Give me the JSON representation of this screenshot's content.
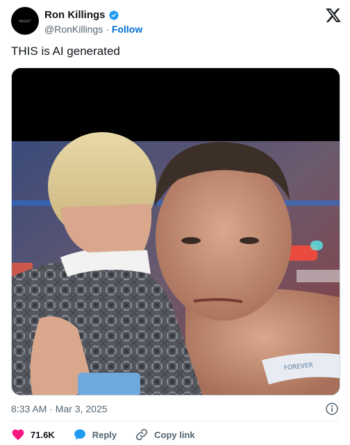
{
  "tweet": {
    "author": {
      "display_name": "Ron Killings",
      "handle": "@RonKillings",
      "follow_label": "Follow",
      "avatar_text": "RKLEST",
      "verified": true
    },
    "separator": "·",
    "text": "THIS is AI generated",
    "timestamp": "8:33 AM · Mar 3, 2025",
    "actions": {
      "like_count": "71.6K",
      "reply_label": "Reply",
      "copy_link_label": "Copy link"
    },
    "media": {
      "description_icon": "photo",
      "wristband_text": "FOREVER"
    }
  },
  "icons": {
    "verified": "verified-badge-icon",
    "logo": "x-logo-icon",
    "info": "info-icon",
    "like": "heart-icon",
    "reply": "speech-bubble-icon",
    "copy_link": "link-icon"
  },
  "colors": {
    "like": "#f91880",
    "reply": "#1d9bf0",
    "follow": "#006fd6",
    "verified": "#1d9bf0",
    "secondary_text": "#536471"
  }
}
